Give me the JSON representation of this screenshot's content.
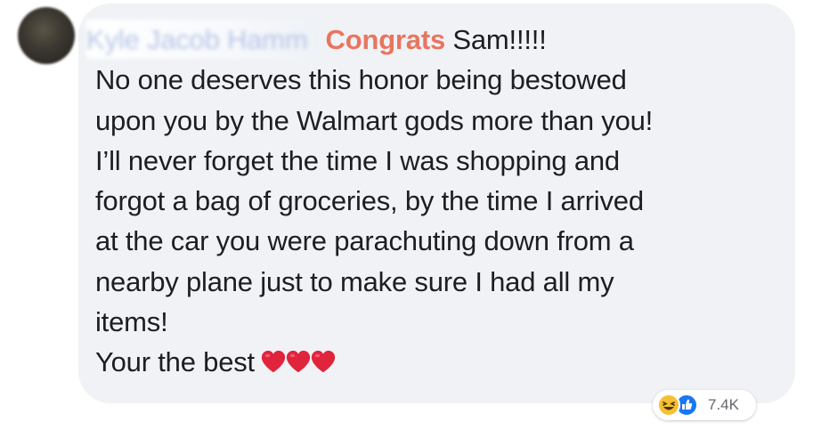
{
  "comment": {
    "author": "Kyle Jacob Hamm",
    "highlight": "Congrats",
    "lines": [
      " Sam!!!!!",
      "No one deserves this honor being bestowed",
      "upon you by the Walmart gods more than you!",
      "I’ll never forget the time I was shopping and",
      "forgot a bag of groceries, by the time I arrived",
      "at the car you were parachuting down from a",
      "nearby plane just to make sure I had all my",
      "items!",
      "Your the best"
    ],
    "emoji": [
      "heart-emoji",
      "heart-emoji",
      "heart-emoji"
    ]
  },
  "reactions": {
    "icons": [
      "haha-icon",
      "like-icon"
    ],
    "count": "7.4K"
  },
  "colors": {
    "bubble": "#f0f2f5",
    "text": "#1c1e21",
    "highlight": "#e9755f",
    "heart": "#e0243c",
    "haha": "#f7c033",
    "like": "#1877f2",
    "count": "#65676b"
  }
}
